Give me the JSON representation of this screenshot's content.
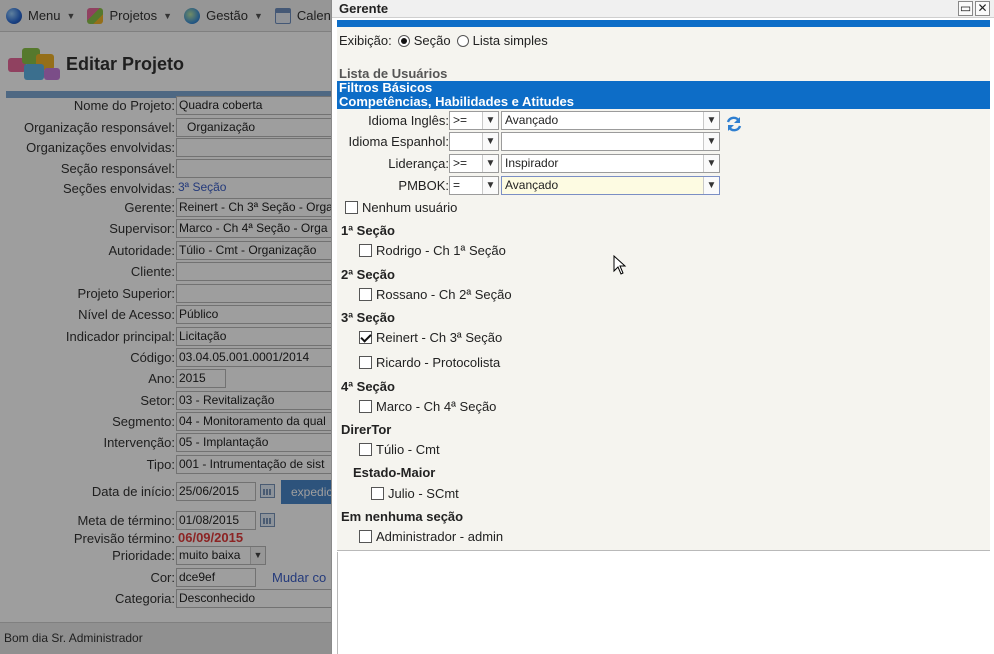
{
  "topbar": {
    "items": [
      {
        "label": "Menu",
        "icon": "color-drop-icon"
      },
      {
        "label": "Projetos",
        "icon": "puzzle-icon"
      },
      {
        "label": "Gestão",
        "icon": "globe-icon"
      },
      {
        "label": "Calendár",
        "icon": "calendar-icon"
      }
    ]
  },
  "project_form": {
    "title": "Editar Projeto",
    "fields": [
      {
        "label": "Nome do Projeto:",
        "value": "Quadra coberta"
      },
      {
        "label": "Organização responsável:",
        "value": "Organização"
      },
      {
        "label": "Organizações envolvidas:",
        "value": ""
      },
      {
        "label": "Seção responsável:",
        "value": ""
      },
      {
        "label": "Seções envolvidas:",
        "value": "3ª Seção"
      },
      {
        "label": "Gerente:",
        "value": "Reinert - Ch 3ª Seção - Orga"
      },
      {
        "label": "Supervisor:",
        "value": "Marco - Ch 4ª Seção - Orga"
      },
      {
        "label": "Autoridade:",
        "value": "Túlio - Cmt - Organização"
      },
      {
        "label": "Cliente:",
        "value": ""
      },
      {
        "label": "Projeto Superior:",
        "value": ""
      },
      {
        "label": "Nível de Acesso:",
        "value": "Público"
      },
      {
        "label": "Indicador principal:",
        "value": "Licitação"
      },
      {
        "label": "Código:",
        "value": "03.04.05.001.0001/2014"
      },
      {
        "label": "Ano:",
        "value": "2015"
      },
      {
        "label": "Setor:",
        "value": "03 - Revitalização"
      },
      {
        "label": "Segmento:",
        "value": "04 - Monitoramento da qual"
      },
      {
        "label": "Intervenção:",
        "value": "05 - Implantação"
      },
      {
        "label": "Tipo:",
        "value": "001 - Intrumentação de sist"
      },
      {
        "label": "Data de início:",
        "value": "25/06/2015"
      },
      {
        "label": "Meta de término:",
        "value": "01/08/2015"
      },
      {
        "label": "Previsão término:",
        "value": "06/09/2015"
      },
      {
        "label": "Prioridade:",
        "value": "muito baixa"
      },
      {
        "label": "Cor:",
        "value": "dce9ef"
      },
      {
        "label": "Categoria:",
        "value": "Desconhecido"
      }
    ],
    "expedit_label": "expedic",
    "mudar_label": "Mudar co"
  },
  "status": {
    "text": "Bom dia Sr. Administrador"
  },
  "dialog": {
    "title": "Gerente",
    "exibicao_label": "Exibição:",
    "option_secao": "Seção",
    "option_lista": "Lista simples",
    "selected_option": "Seção",
    "lista_title": "Lista de Usuários",
    "band1": "Filtros Básicos",
    "band2": "Competências, Habilidades e Atitudes",
    "filters": [
      {
        "label": "Idioma Inglês:",
        "op": ">=",
        "value": "Avançado"
      },
      {
        "label": "Idioma Espanhol:",
        "op": "",
        "value": ""
      },
      {
        "label": "Liderança:",
        "op": ">=",
        "value": "Inspirador"
      },
      {
        "label": "PMBOK:",
        "op": "=",
        "value": "Avançado"
      }
    ],
    "nenhum_usuario": "Nenhum usuário",
    "groups": [
      {
        "title": "1ª Seção",
        "users": [
          {
            "name": "Rodrigo - Ch 1ª Seção",
            "checked": false
          }
        ]
      },
      {
        "title": "2ª Seção",
        "users": [
          {
            "name": "Rossano - Ch 2ª Seção",
            "checked": false
          }
        ]
      },
      {
        "title": "3ª Seção",
        "users": [
          {
            "name": "Reinert - Ch 3ª Seção",
            "checked": true
          },
          {
            "name": "Ricardo - Protocolista",
            "checked": false
          }
        ]
      },
      {
        "title": "4ª Seção",
        "users": [
          {
            "name": "Marco - Ch 4ª Seção",
            "checked": false
          }
        ]
      },
      {
        "title": "DirerTor",
        "users": [
          {
            "name": "Túlio - Cmt",
            "checked": false
          }
        ]
      },
      {
        "title": "Estado-Maior",
        "users": [
          {
            "name": "Julio - SCmt",
            "checked": false
          }
        ]
      },
      {
        "title": "Em nenhuma seção",
        "users": [
          {
            "name": "Administrador - admin",
            "checked": false
          }
        ]
      }
    ]
  }
}
